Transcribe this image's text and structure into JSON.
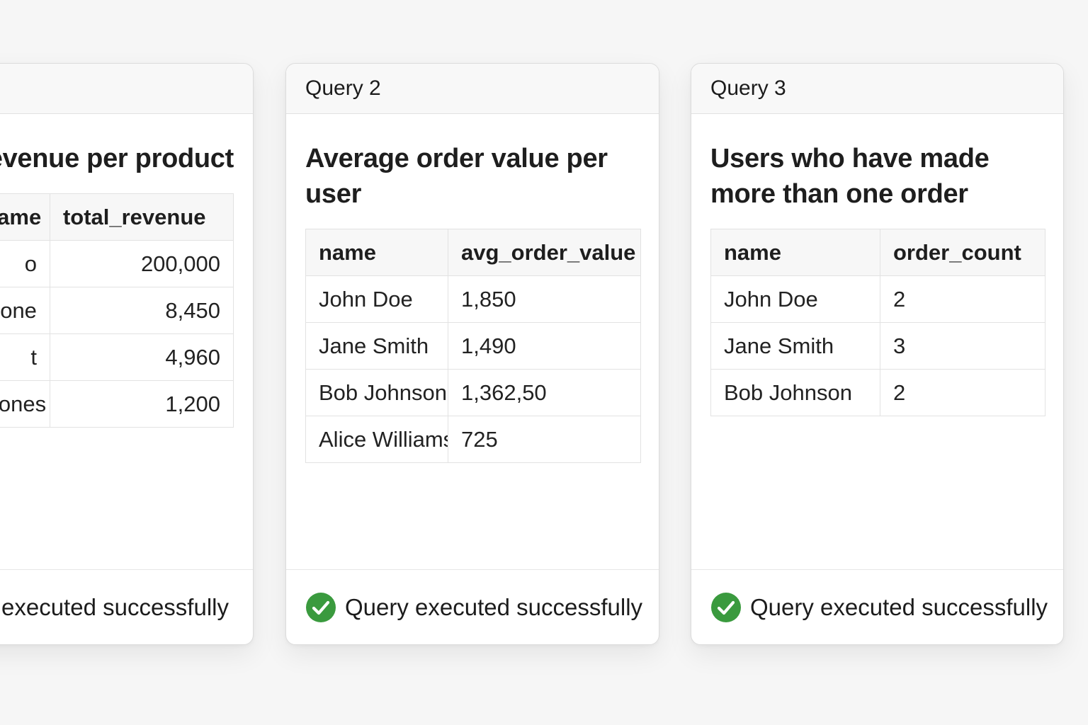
{
  "colors": {
    "background": "#f6f6f6",
    "card": "#ffffff",
    "success": "#3a9a3e"
  },
  "cards": [
    {
      "header": "",
      "title": "evenue per product",
      "columns": [
        "_name",
        "total_revenue"
      ],
      "rows": [
        [
          "o",
          "200,000"
        ],
        [
          "phone",
          "8,450"
        ],
        [
          "t",
          "4,960"
        ],
        [
          "Phones",
          "1,200"
        ]
      ],
      "status": "y executed successfully"
    },
    {
      "header": "Query 2",
      "title": "Average order value per user",
      "columns": [
        "name",
        "avg_order_value"
      ],
      "rows": [
        [
          "John Doe",
          "1,850"
        ],
        [
          "Jane Smith",
          "1,490"
        ],
        [
          "Bob Johnson",
          "1,362,50"
        ],
        [
          "Alice Williams",
          "725"
        ]
      ],
      "status_icon": "check-circle-icon",
      "status": "Query executed successfully"
    },
    {
      "header": "Query 3",
      "title": "Users who have made more than one order",
      "columns": [
        "name",
        "order_count"
      ],
      "rows": [
        [
          "John Doe",
          "2"
        ],
        [
          "Jane Smith",
          "3"
        ],
        [
          "Bob Johnson",
          "2"
        ]
      ],
      "status_icon": "check-circle-icon",
      "status": "Query executed successfully"
    }
  ]
}
